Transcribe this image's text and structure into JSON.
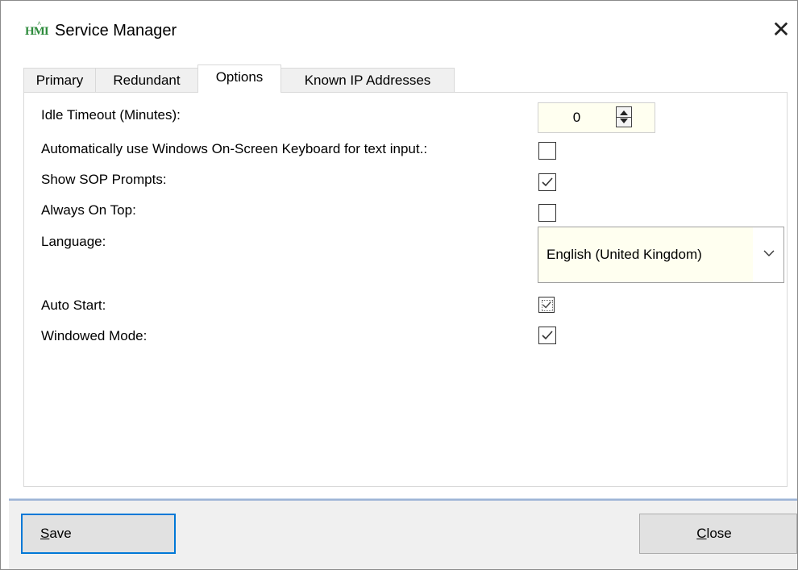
{
  "window": {
    "title": "Service Manager",
    "icon_text": "HMI",
    "close_glyph": "✕"
  },
  "tabs": [
    {
      "label": "Primary",
      "active": false
    },
    {
      "label": "Redundant",
      "active": false
    },
    {
      "label": "Options",
      "active": true
    },
    {
      "label": "Known IP Addresses",
      "active": false
    }
  ],
  "options": {
    "idle_timeout_label": "Idle Timeout (Minutes):",
    "idle_timeout_value": "0",
    "osk_label": "Automatically use Windows On-Screen Keyboard for text input.:",
    "osk_checked": false,
    "sop_label": "Show SOP Prompts:",
    "sop_checked": true,
    "always_on_top_label": "Always On Top:",
    "always_on_top_checked": false,
    "language_label": "Language:",
    "language_value": "English (United Kingdom)",
    "auto_start_label": "Auto Start:",
    "auto_start_state": "indeterminate-checked",
    "windowed_label": "Windowed Mode:",
    "windowed_checked": true
  },
  "footer": {
    "save_label_access": "S",
    "save_label_rest": "ave",
    "close_label_access": "C",
    "close_label_rest": "lose"
  }
}
